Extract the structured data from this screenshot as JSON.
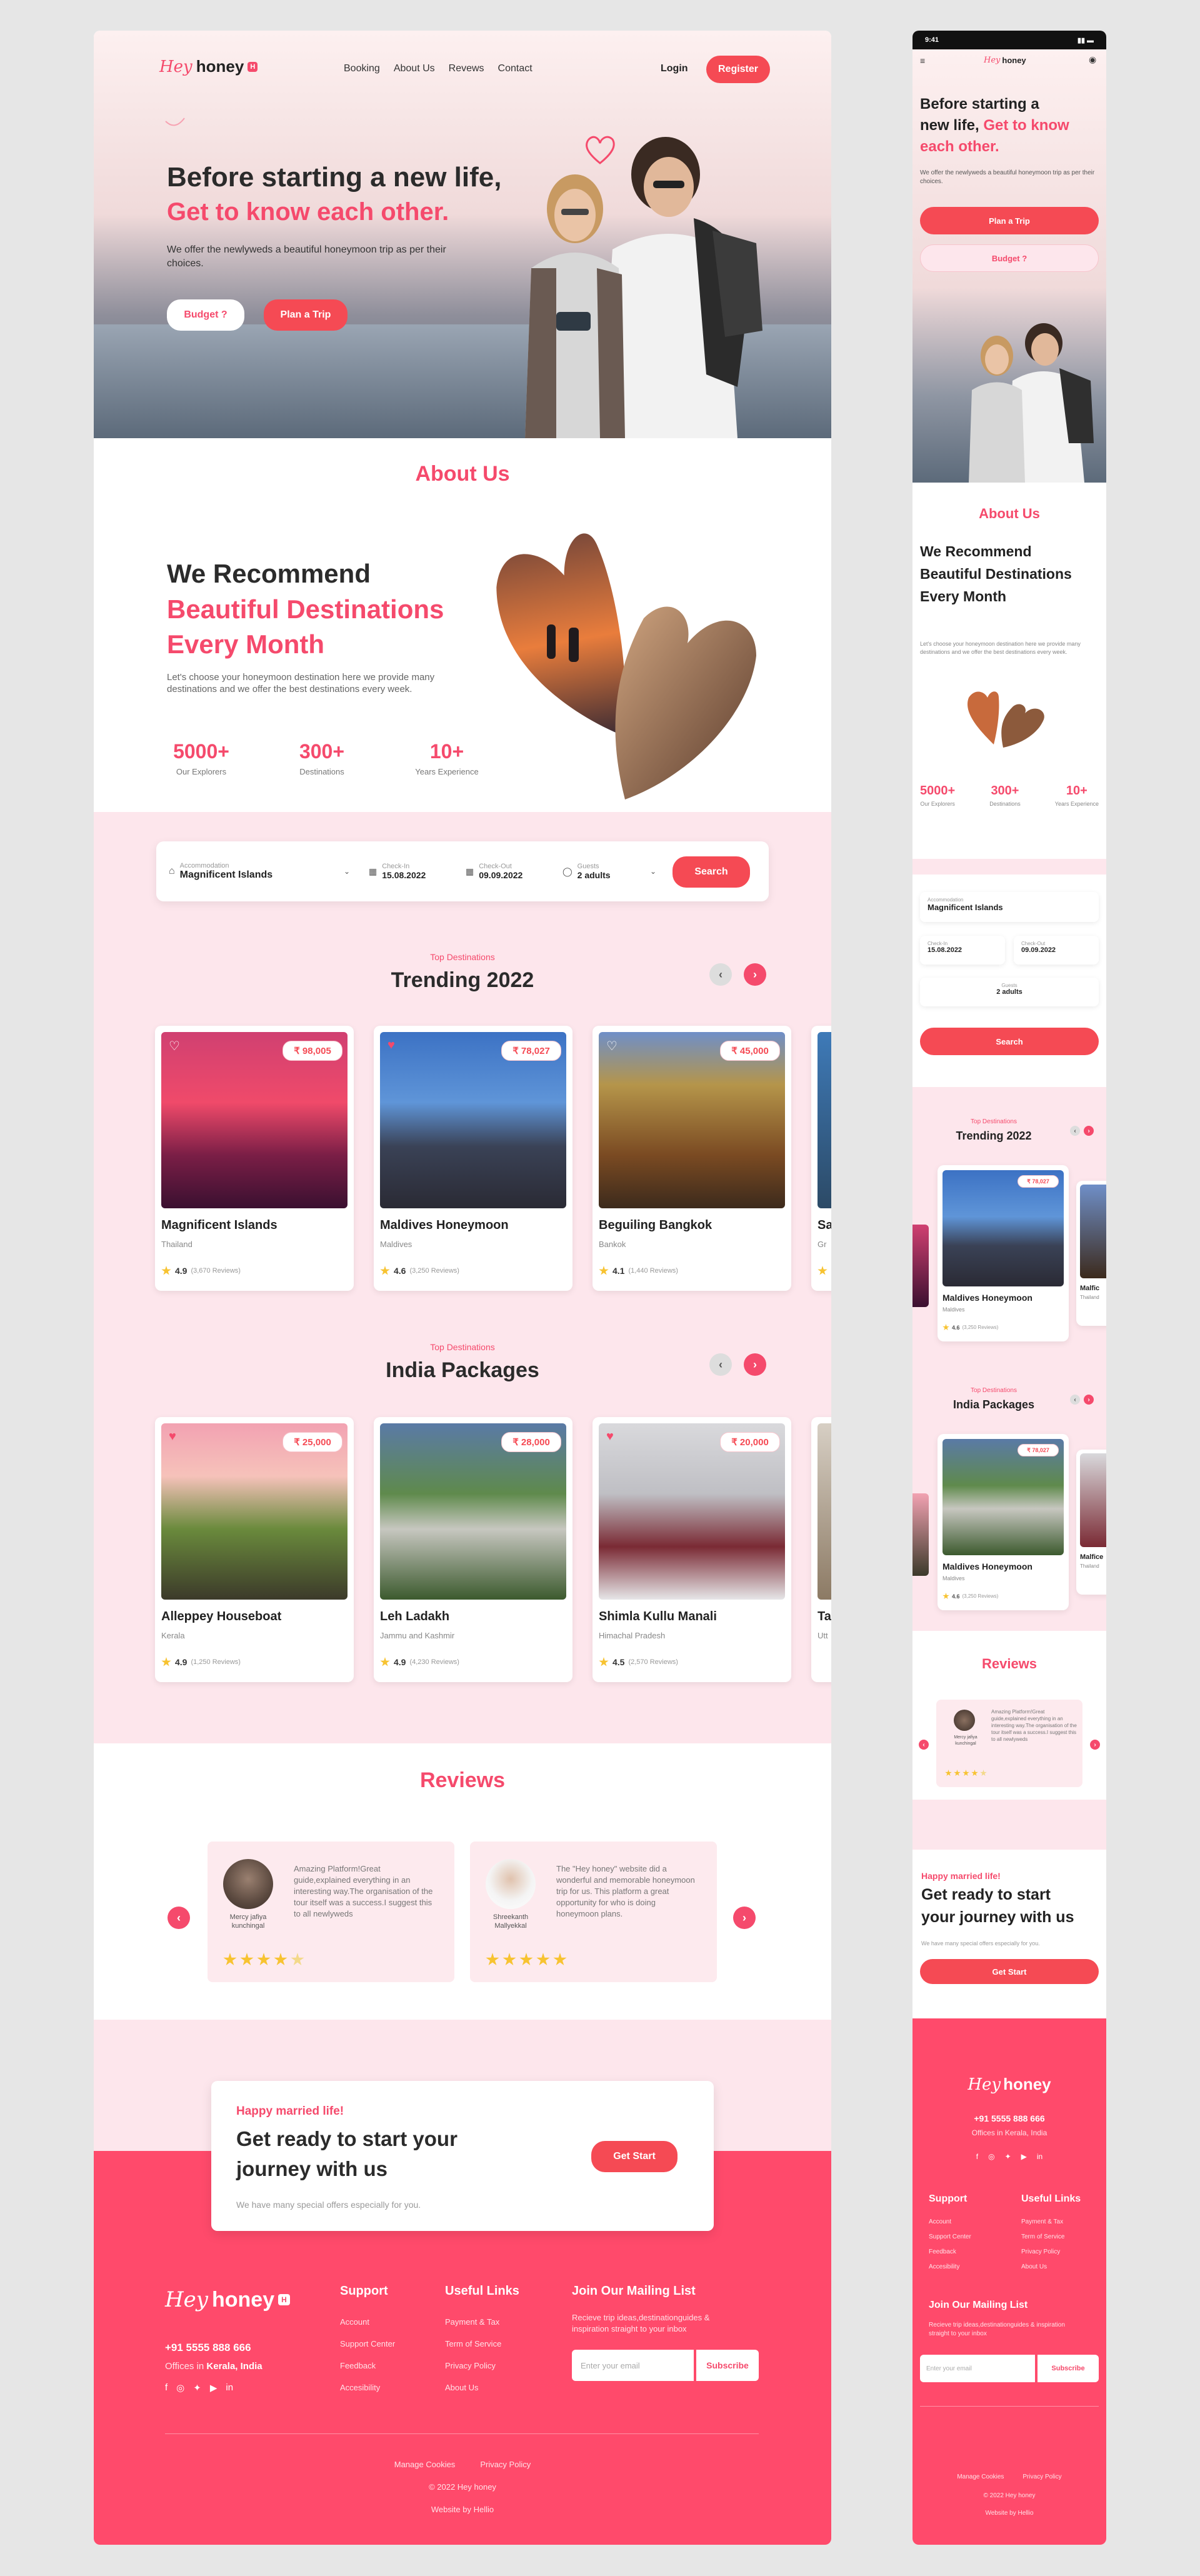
{
  "brand": {
    "script": "Hey",
    "name": "honey",
    "badge": "H"
  },
  "nav": {
    "items": [
      "Booking",
      "About Us",
      "Revews",
      "Contact"
    ],
    "login": "Login",
    "register": "Register"
  },
  "hero": {
    "title_line1": "Before starting a new life,",
    "title_line2": "Get to know each other.",
    "subtitle": "We offer the newlyweds a beautiful honeymoon trip as per their choices.",
    "budget_btn": "Budget ?",
    "plan_btn": "Plan a Trip"
  },
  "about": {
    "section_title": "About Us",
    "head1": "We Recommend",
    "head2": "Beautiful Destinations",
    "head3": "Every Month",
    "desc": "Let's choose your honeymoon destination here we provide many destinations and we offer the best destinations every week.",
    "stats": [
      {
        "value": "5000+",
        "label": "Our Explorers"
      },
      {
        "value": "300+",
        "label": "Destinations"
      },
      {
        "value": "10+",
        "label": "Years Experience"
      }
    ]
  },
  "search": {
    "accommodation_label": "Accommodation",
    "accommodation_value": "Magnificent Islands",
    "checkin_label": "Check-In",
    "checkin_value": "15.08.2022",
    "checkout_label": "Check-Out",
    "checkout_value": "09.09.2022",
    "guests_label": "Guests",
    "guests_value": "2 adults",
    "button": "Search"
  },
  "trending": {
    "eyebrow": "Top Destinations",
    "title": "Trending 2022",
    "cards": [
      {
        "name": "Magnificent Islands",
        "location": "Thailand",
        "price": "₹ 98,005",
        "rating": "4.9",
        "reviews": "(3,670 Reviews)"
      },
      {
        "name": "Maldives Honeymoon",
        "location": "Maldives",
        "price": "₹ 78,027",
        "rating": "4.6",
        "reviews": "(3,250 Reviews)"
      },
      {
        "name": "Beguiling Bangkok",
        "location": "Bankok",
        "price": "₹ 45,000",
        "rating": "4.1",
        "reviews": "(1,440 Reviews)"
      },
      {
        "name": "Sa",
        "location": "Gr",
        "price": "",
        "rating": "",
        "reviews": ""
      }
    ]
  },
  "india": {
    "eyebrow": "Top Destinations",
    "title": "India Packages",
    "cards": [
      {
        "name": "Alleppey Houseboat",
        "location": "Kerala",
        "price": "₹ 25,000",
        "rating": "4.9",
        "reviews": "(1,250 Reviews)"
      },
      {
        "name": "Leh Ladakh",
        "location": "Jammu and Kashmir",
        "price": "₹ 28,000",
        "rating": "4.9",
        "reviews": "(4,230 Reviews)"
      },
      {
        "name": "Shimla Kullu Manali",
        "location": "Himachal Pradesh",
        "price": "₹ 20,000",
        "rating": "4.5",
        "reviews": "(2,570 Reviews)"
      },
      {
        "name": "Ta",
        "location": "Utt",
        "price": "",
        "rating": "",
        "reviews": ""
      }
    ]
  },
  "reviews": {
    "title": "Reviews",
    "items": [
      {
        "name": "Mercy jafiya kunchingal",
        "text": "Amazing Platform!Great guide,explained everything in an interesting way.The organisation of the tour itself was a success.I suggest this to all newlyweds",
        "stars": 4
      },
      {
        "name": "Shreekanth Mallyekkal",
        "text": "The \"Hey honey\" website did a wonderful and memorable honeymoon trip for us. This platform a great opportunity for who is doing honeymoon plans.",
        "stars": 5
      }
    ]
  },
  "cta": {
    "eyebrow": "Happy married life!",
    "title_line1": "Get ready to start your",
    "title_line2": "journey with us",
    "sub": "We have many special offers especially for you.",
    "button": "Get Start"
  },
  "footer": {
    "phone": "+91 5555 888 666",
    "office_prefix": "Offices in",
    "office_place": "Kerala, India",
    "support_title": "Support",
    "support_links": [
      "Account",
      "Support Center",
      "Feedback",
      "Accesibility"
    ],
    "useful_title": "Useful Links",
    "useful_links": [
      "Payment & Tax",
      "Term of Service",
      "Privacy Policy",
      "About Us"
    ],
    "mailing_title": "Join Our Mailing List",
    "mailing_desc": "Recieve trip ideas,destinationguides & inspiration straight to your inbox",
    "email_placeholder": "Enter your email",
    "subscribe": "Subscribe",
    "bottom_links": [
      "Manage Cookies",
      "Privacy Policy"
    ],
    "copyright": "© 2022 Hey honey",
    "credit": "Website by Hellio"
  },
  "mobile": {
    "time": "9:41",
    "hero_line1": "Before starting a",
    "hero_line2": "new life,",
    "hero_pink1": "Get to know",
    "hero_pink2": "each other.",
    "about_head": "We Recommend Beautiful Destinations Every Month",
    "trending_card": {
      "name": "Maldives Honeymoon",
      "location": "Maldives",
      "price": "₹ 78,027",
      "rating": "4.6",
      "reviews": "(3,250 Reviews)"
    },
    "trending_side": "Malfic",
    "trending_side_loc": "Thailand",
    "india_card": {
      "name": "Maldives Honeymoon",
      "location": "Maldives",
      "price": "₹ 78,027",
      "rating": "4.6",
      "reviews": "(3,250 Reviews)"
    },
    "india_side": "Malfice",
    "india_side_loc": "Thailand",
    "review_name": "Mercy jafiya kunchingal",
    "review_text": "Amazing Platform!Great guide,explained everything in an interesting way.The organisation of the tour itself was a success.I suggest this to all newlyweds",
    "cta_line1": "Get ready to start",
    "cta_line2": "your journey with us",
    "copyright": "© 2022 Hey honey"
  },
  "colors": {
    "accent": "#f54a6c",
    "button": "#f54a54",
    "footer": "#ff4a6b",
    "soft": "#fde6ec"
  }
}
